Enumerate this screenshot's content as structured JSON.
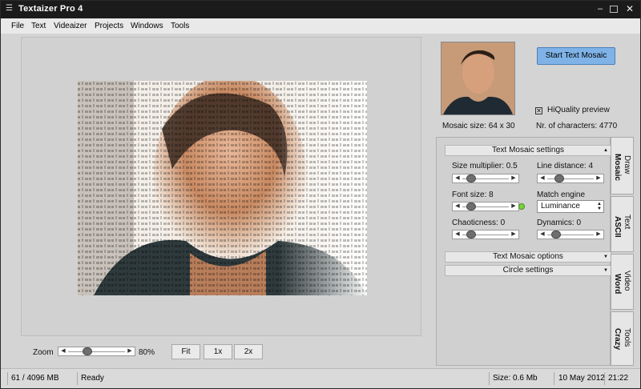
{
  "window": {
    "title": "Textaizer Pro 4"
  },
  "menu": [
    "File",
    "Text",
    "Videaizer",
    "Projects",
    "Windows",
    "Tools"
  ],
  "toolbar": {
    "start_label": "Start Text Mosaic",
    "hiquality_label": "HiQuality preview",
    "hiquality_checked": true,
    "mosaic_size": "Mosaic size: 64 x 30",
    "characters": "Nr. of characters: 4770"
  },
  "mosaic_settings": {
    "header": "Text Mosaic settings",
    "size_multiplier": {
      "label": "Size multiplier: 0.5",
      "level": 0.1
    },
    "line_distance": {
      "label": "Line distance: 4",
      "level": 0.2
    },
    "font_size": {
      "label": "Font size: 8",
      "level": 0.1
    },
    "match_engine": {
      "label": "Match engine",
      "value": "Luminance"
    },
    "chaoticness": {
      "label": "Chaoticness: 0",
      "level": 0.1
    },
    "dynamics": {
      "label": "Dynamics: 0",
      "level": 0.1
    },
    "options_header": "Text Mosaic options",
    "circle_header": "Circle settings"
  },
  "vertical_tabs": [
    {
      "main": "Draw",
      "sub": "Mosaic"
    },
    {
      "main": "Text",
      "sub": "ASCII"
    },
    {
      "main": "Video",
      "sub": "Word"
    },
    {
      "main": "Tools",
      "sub": "Crazy"
    }
  ],
  "zoom": {
    "label": "Zoom",
    "value": "80%",
    "level": 0.3,
    "buttons": [
      "Fit",
      "1x",
      "2x"
    ]
  },
  "status": {
    "memory": "61 / 4096 MB",
    "state": "Ready",
    "size": "Size: 0.6 Mb",
    "date": "10 May 2012",
    "time": "21:22"
  },
  "colors": {
    "accent_button": "#7fb3e8",
    "titlebar": "#1b1b1b",
    "panel": "#d4d4d4"
  },
  "icons": {
    "app": "app-menu-icon",
    "minimize": "minimize-icon",
    "maximize": "maximize-icon",
    "close": "close-icon"
  }
}
